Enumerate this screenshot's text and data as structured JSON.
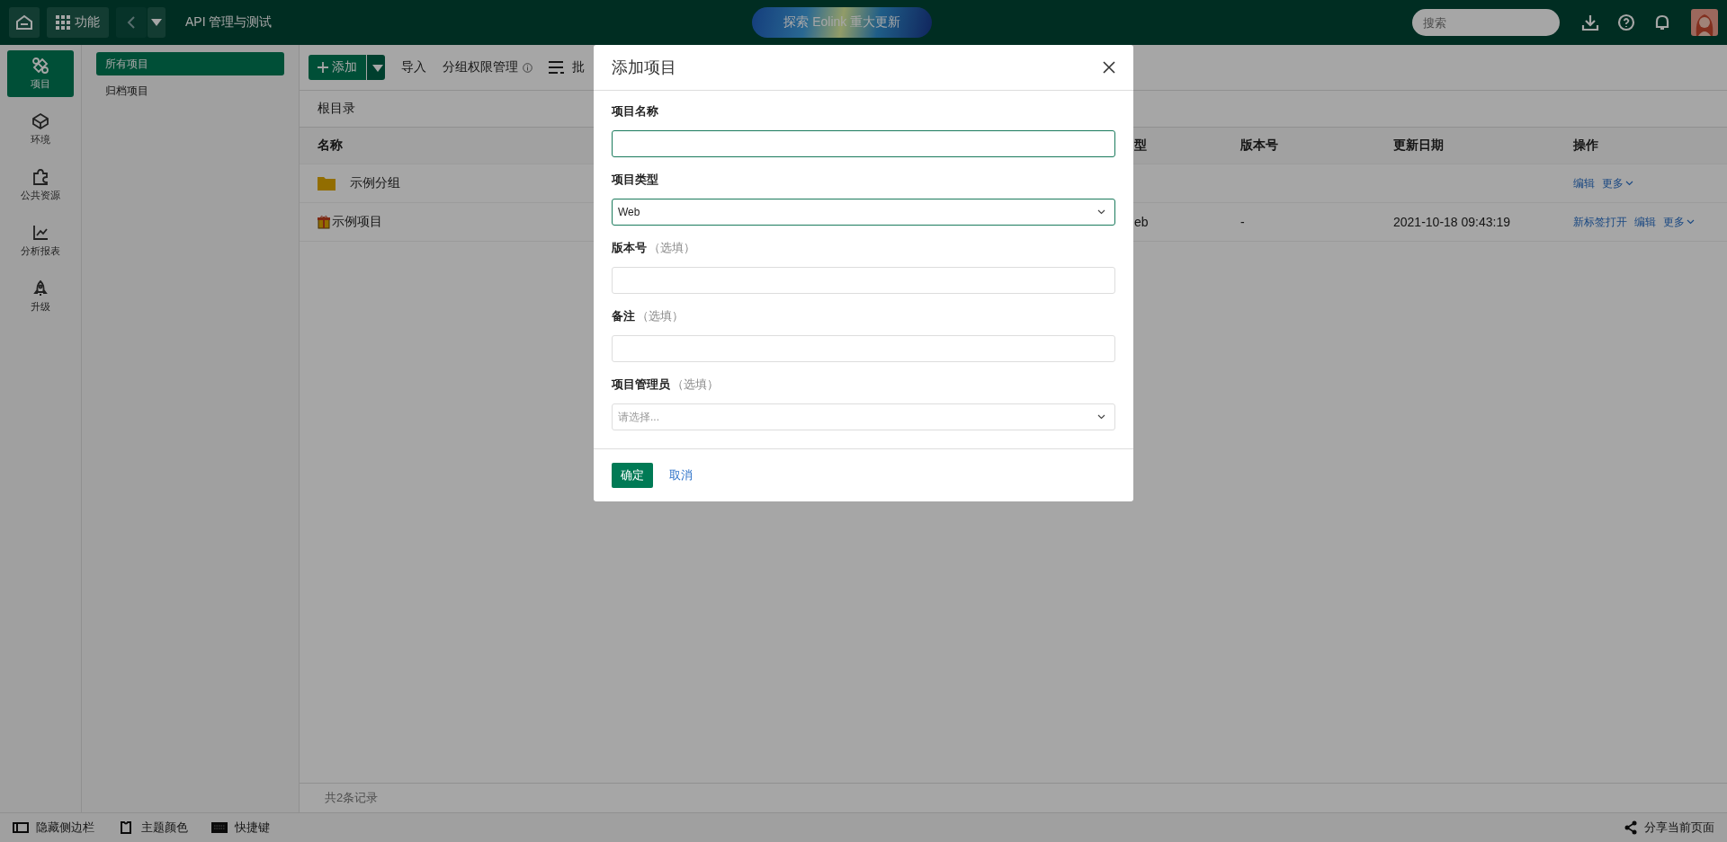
{
  "top_bar": {
    "menu_button": "功能",
    "app_title": "API 管理与测试",
    "banner": "探索 Eolink 重大更新",
    "search": {
      "placeholder": "搜索"
    }
  },
  "nav": [
    {
      "label": "项目",
      "kind": "project",
      "selected": true
    },
    {
      "label": "环境",
      "kind": "env",
      "selected": false
    },
    {
      "label": "公共资源",
      "kind": "puzzle",
      "selected": false
    },
    {
      "label": "分析报表",
      "kind": "chart",
      "selected": false
    },
    {
      "label": "升级",
      "kind": "rocket",
      "selected": false
    }
  ],
  "groups": [
    {
      "label": "所有项目",
      "selected": true
    },
    {
      "label": "归档项目",
      "selected": false
    }
  ],
  "toolbar": {
    "add": "添加",
    "actions": [
      {
        "label": "导入",
        "kind": "plain"
      },
      {
        "label": "分组权限管理",
        "kind": "info"
      },
      {
        "label": "批",
        "kind": "list"
      }
    ]
  },
  "breadcrumb": "根目录",
  "table": {
    "columns": [
      "名称",
      "型",
      "版本号",
      "更新日期",
      "操作"
    ],
    "rows": [
      {
        "kind": "folder",
        "name": "示例分组",
        "actions": [
          {
            "label": "编辑",
            "kind": "link"
          },
          {
            "label": "更多",
            "kind": "menu"
          }
        ]
      },
      {
        "kind": "gift",
        "name": "示例项目",
        "type": "eb",
        "version": "-",
        "date": "2021-10-18 09:43:19",
        "actions": [
          {
            "label": "新标签打开",
            "kind": "link"
          },
          {
            "label": "编辑",
            "kind": "link"
          },
          {
            "label": "更多",
            "kind": "menu"
          }
        ]
      }
    ]
  },
  "footer": "共2条记录",
  "bottom_bar": [
    {
      "label": "隐藏侧边栏",
      "kind": "sidebar"
    },
    {
      "label": "主题颜色",
      "kind": "shirt"
    },
    {
      "label": "快捷键",
      "kind": "keyboard"
    }
  ],
  "share": "分享当前页面",
  "dialog": {
    "title": "添加项目",
    "fields": [
      {
        "label": "项目名称",
        "kind": "text",
        "focused": true
      },
      {
        "label": "项目类型",
        "kind": "select",
        "value": "Web",
        "focused": true
      },
      {
        "label": "版本号",
        "hint": "（选填）",
        "kind": "text",
        "focused": false
      },
      {
        "label": "备注",
        "hint": "（选填）",
        "kind": "text",
        "focused": false
      },
      {
        "label": "项目管理员",
        "hint": "（选填）",
        "kind": "select",
        "placeholder": "请选择...",
        "focused": false
      }
    ],
    "confirm": "确定",
    "cancel": "取消"
  }
}
